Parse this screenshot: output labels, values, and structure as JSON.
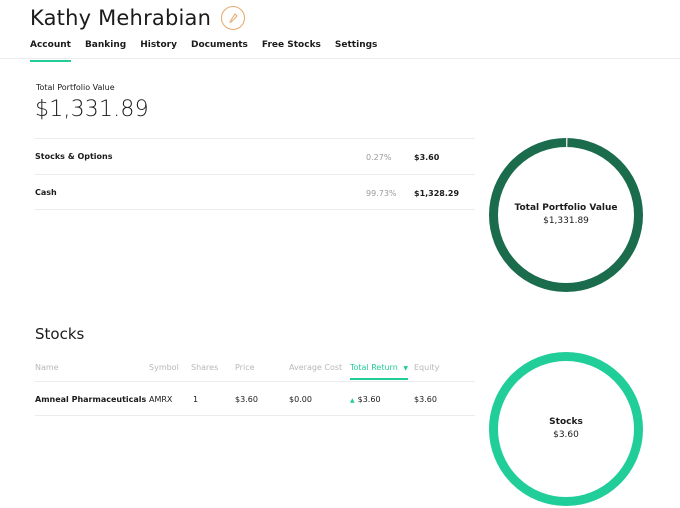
{
  "header": {
    "user_name": "Kathy Mehrabian",
    "badge_icon": "rocket-icon"
  },
  "tabs": [
    "Account",
    "Banking",
    "History",
    "Documents",
    "Free Stocks",
    "Settings"
  ],
  "active_tab": "Account",
  "portfolio": {
    "label": "Total Portfolio Value",
    "value": "$1,331.89",
    "allocations": [
      {
        "label": "Stocks & Options",
        "percent": "0.27%",
        "amount": "$3.60"
      },
      {
        "label": "Cash",
        "percent": "99.73%",
        "amount": "$1,328.29"
      }
    ]
  },
  "portfolio_chart": {
    "title": "Total Portfolio Value",
    "value": "$1,331.89",
    "slices": [
      {
        "label": "Stocks & Options",
        "fraction": 0.0027,
        "color": "#e0e0e0"
      },
      {
        "label": "Cash",
        "fraction": 0.9973,
        "color": "#1b6b4d"
      }
    ]
  },
  "stocks": {
    "title": "Stocks",
    "columns": [
      "Name",
      "Symbol",
      "Shares",
      "Price",
      "Average Cost",
      "Total Return",
      "Equity"
    ],
    "sorted_column": "Total Return",
    "rows": [
      {
        "name": "Amneal Pharmaceuticals",
        "symbol": "AMRX",
        "shares": "1",
        "price": "$3.60",
        "average_cost": "$0.00",
        "total_return": "$3.60",
        "equity": "$3.60"
      }
    ]
  },
  "stocks_chart": {
    "title": "Stocks",
    "value": "$3.60",
    "color": "#21ce99"
  },
  "colors": {
    "accent": "#21ce99",
    "dark_green": "#1b6b4d",
    "badge": "#e5a86b"
  }
}
